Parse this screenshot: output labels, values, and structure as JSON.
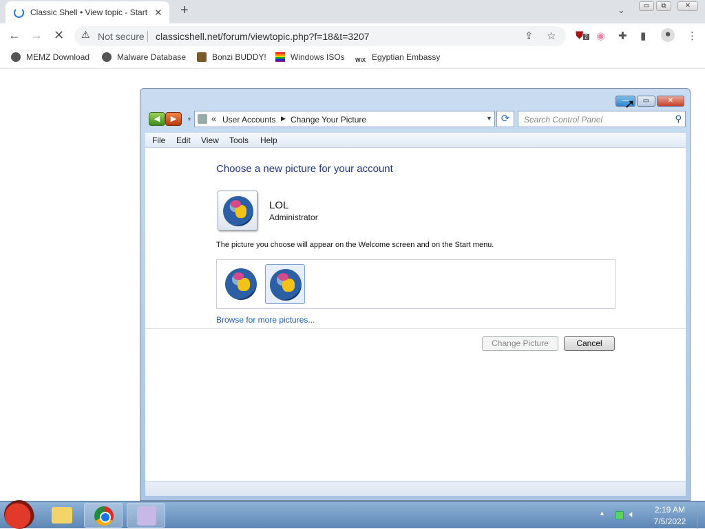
{
  "browser": {
    "tab_title": "Classic Shell • View topic - Start",
    "tab_close": "✕",
    "new_tab": "+",
    "tab_menu": "⌄",
    "window_controls": [
      "▭",
      "⧉",
      "✕"
    ],
    "nav": {
      "back": "←",
      "forward": "→",
      "stop": "✕"
    },
    "security_label": "Not secure",
    "url": "classicshell.net/forum/viewtopic.php?f=18&t=3207",
    "extension_badge": "2",
    "bookmarks": [
      {
        "label": "MEMZ Download",
        "icon": "globe-icon"
      },
      {
        "label": "Malware Database",
        "icon": "globe-icon"
      },
      {
        "label": "Bonzi BUDDY!",
        "icon": "bonzi-icon"
      },
      {
        "label": "Windows ISOs",
        "icon": "rainbow-flag-icon"
      },
      {
        "label": "Egyptian Embassy",
        "icon": "wix-icon"
      }
    ]
  },
  "cp_window": {
    "breadcrumb": {
      "chevrons": "«",
      "parent": "User Accounts",
      "arrow": "▶",
      "current": "Change Your Picture"
    },
    "search_placeholder": "Search Control Panel",
    "menu": [
      "File",
      "Edit",
      "View",
      "Tools",
      "Help"
    ],
    "heading": "Choose a new picture for your account",
    "user": {
      "name": "LOL",
      "role": "Administrator"
    },
    "info_text": "The picture you choose will appear on the Welcome screen and on the Start menu.",
    "browse_link": "Browse for more pictures...",
    "buttons": {
      "change": "Change Picture",
      "cancel": "Cancel"
    },
    "caption": {
      "close": "✕",
      "max": "▭",
      "min": "—"
    },
    "selected_picture_index": 2
  },
  "taskbar": {
    "time": "2:19 AM",
    "date": "7/5/2022"
  },
  "colors": {
    "heading": "#1e3287",
    "link": "#1e5fb5",
    "taskbar": "#5d86b5"
  }
}
